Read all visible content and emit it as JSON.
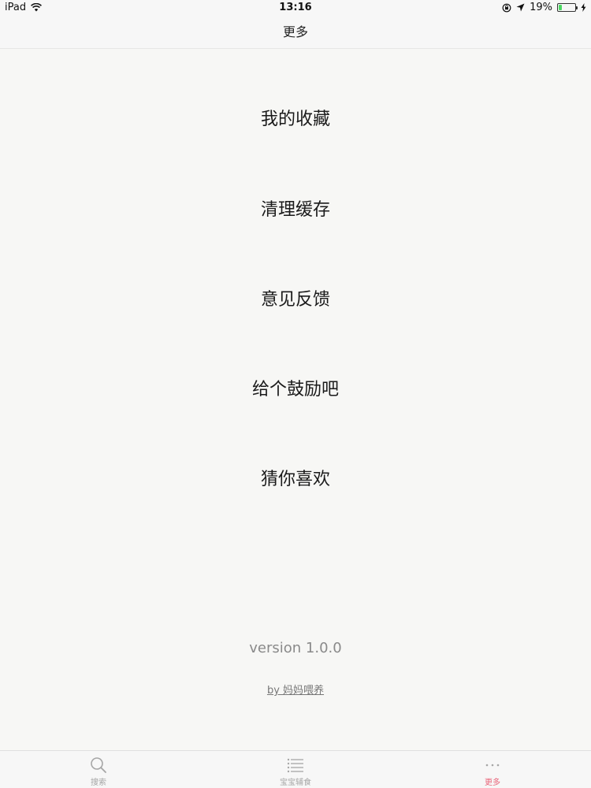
{
  "status_bar": {
    "device": "iPad",
    "time": "13:16",
    "battery_percent": "19%",
    "battery_level": 0.19,
    "accent": "#4cd964"
  },
  "nav": {
    "title": "更多"
  },
  "menu": {
    "items": [
      {
        "label": "我的收藏"
      },
      {
        "label": "清理缓存"
      },
      {
        "label": "意见反馈"
      },
      {
        "label": "给个鼓励吧"
      },
      {
        "label": "猜你喜欢"
      }
    ]
  },
  "footer": {
    "version": "version 1.0.0",
    "by": "by 妈妈喂养"
  },
  "tabs": [
    {
      "label": "搜索",
      "icon": "search-icon",
      "active": false
    },
    {
      "label": "宝宝辅食",
      "icon": "list-icon",
      "active": false
    },
    {
      "label": "更多",
      "icon": "more-icon",
      "active": true
    }
  ],
  "colors": {
    "active_tab": "#e8667a",
    "inactive_tab": "#a6a6a6"
  }
}
